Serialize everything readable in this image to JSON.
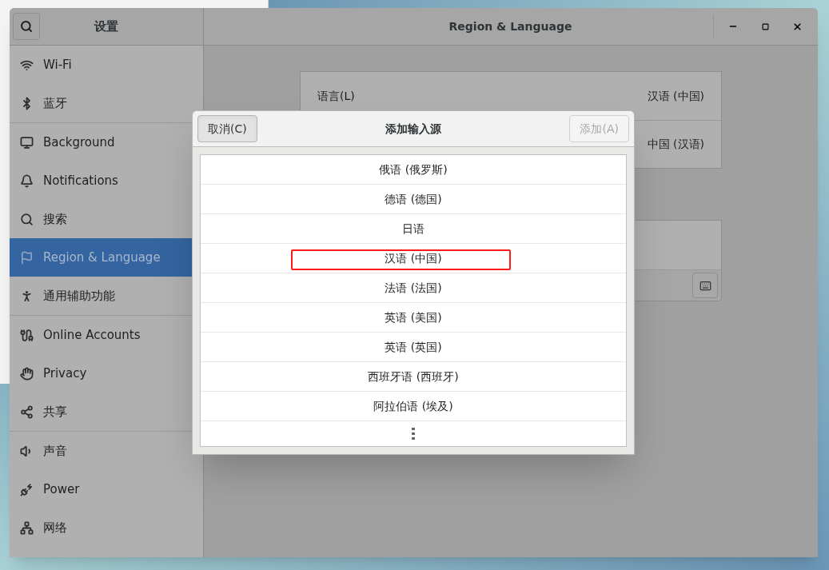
{
  "settings_window": {
    "sidebar_title": "设置",
    "title": "Region & Language"
  },
  "sidebar": {
    "groups": [
      [
        {
          "label": "Wi-Fi",
          "selected": false
        },
        {
          "label": "蓝牙",
          "selected": false
        }
      ],
      [
        {
          "label": "Background",
          "selected": false
        },
        {
          "label": "Notifications",
          "selected": false
        },
        {
          "label": "搜索",
          "selected": false
        },
        {
          "label": "Region & Language",
          "selected": true
        },
        {
          "label": "通用辅助功能",
          "selected": false
        }
      ],
      [
        {
          "label": "Online Accounts",
          "selected": false
        },
        {
          "label": "Privacy",
          "selected": false
        },
        {
          "label": "共享",
          "selected": false
        }
      ],
      [
        {
          "label": "声音",
          "selected": false
        },
        {
          "label": "Power",
          "selected": false
        },
        {
          "label": "网络",
          "selected": false
        }
      ]
    ]
  },
  "region_panel": {
    "rows": [
      {
        "value": "汉语 (中国)",
        "label": "语言(L)"
      },
      {
        "value": "中国 (汉语)"
      }
    ]
  },
  "dialog": {
    "title": "添加输入源",
    "cancel": {
      "label": "取消(C)",
      "disabled": false
    },
    "add": {
      "label": "添加(A)",
      "disabled": true
    },
    "items": [
      {
        "label": "俄语 (俄罗斯)",
        "highlighted": false
      },
      {
        "label": "德语 (德国)",
        "highlighted": false
      },
      {
        "label": "日语",
        "highlighted": false
      },
      {
        "label": "汉语 (中国)",
        "highlighted": true
      },
      {
        "label": "法语 (法国)",
        "highlighted": false
      },
      {
        "label": "英语 (美国)",
        "highlighted": false
      },
      {
        "label": "英语 (英国)",
        "highlighted": false
      },
      {
        "label": "西班牙语 (西班牙)",
        "highlighted": false
      },
      {
        "label": "阿拉伯语 (埃及)",
        "highlighted": false
      }
    ]
  }
}
